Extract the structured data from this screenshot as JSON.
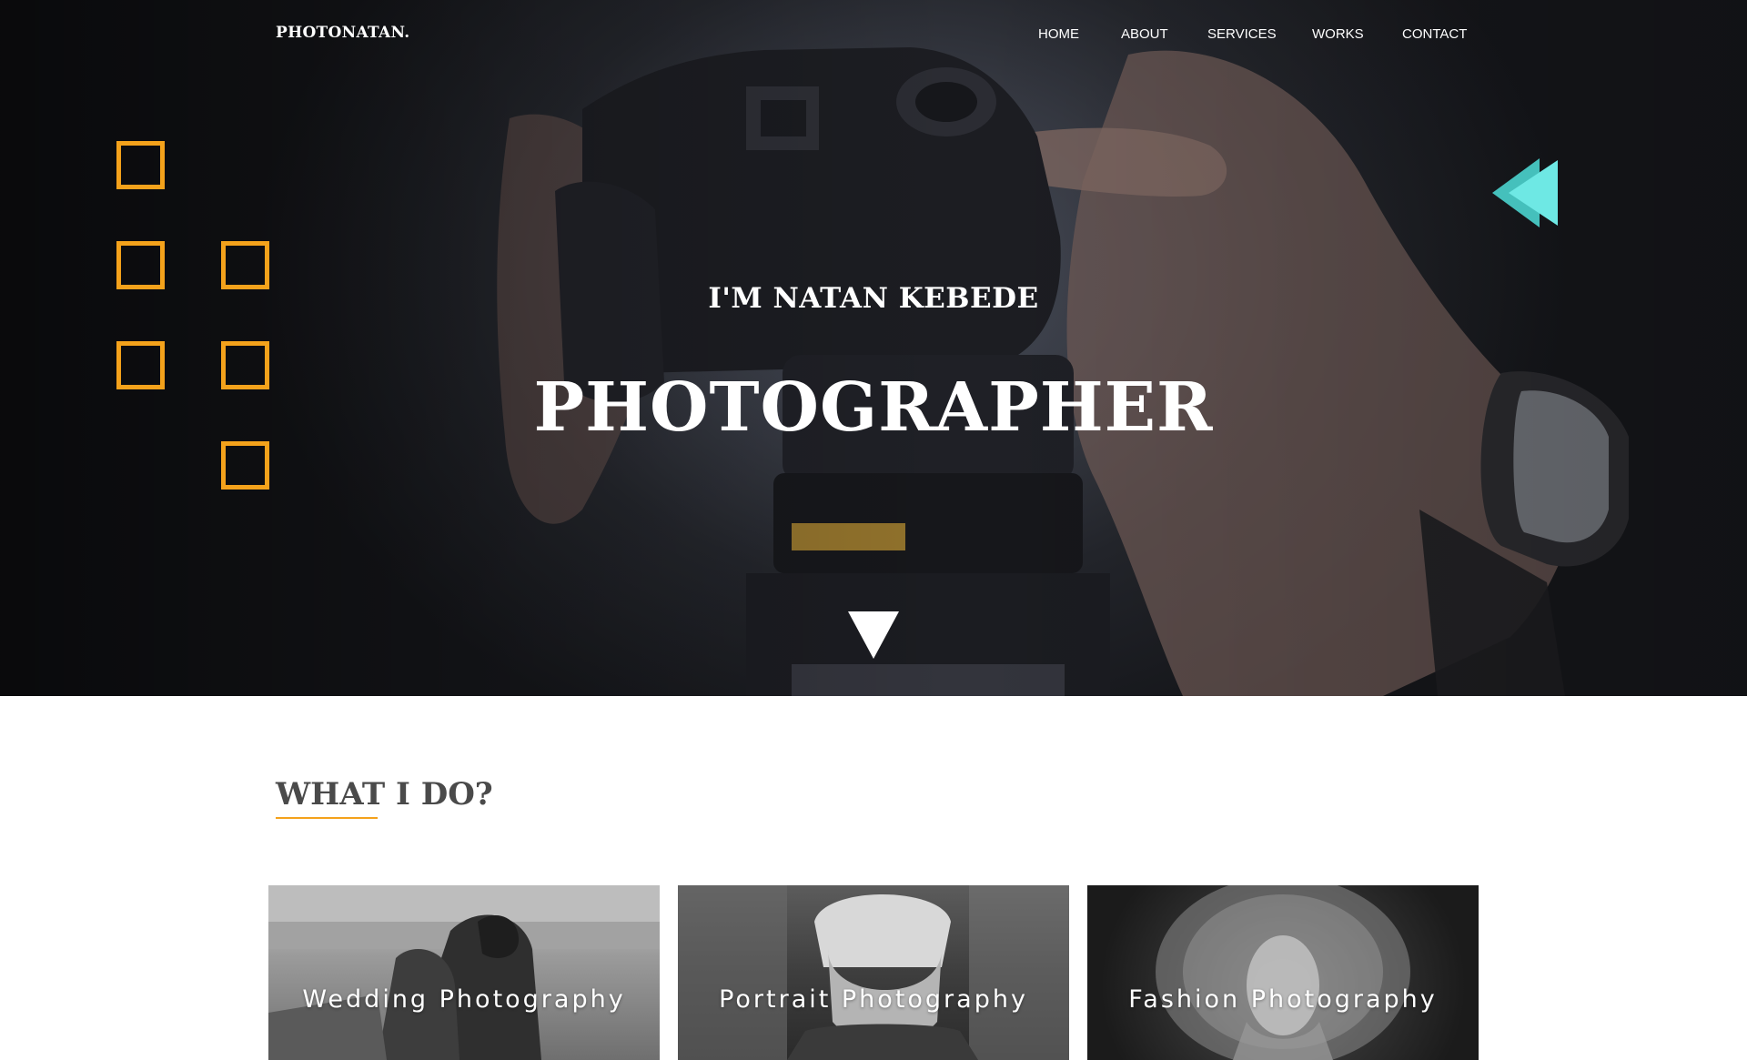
{
  "brand": "PHOTONATAN.",
  "nav": [
    {
      "label": "HOME"
    },
    {
      "label": "ABOUT"
    },
    {
      "label": "SERVICES"
    },
    {
      "label": "WORKS"
    },
    {
      "label": "CONTACT"
    }
  ],
  "hero": {
    "subtitle": "I'M NATAN KEBEDE",
    "title": "PHOTOGRAPHER"
  },
  "services": {
    "title": "WHAT I DO?",
    "cards": [
      {
        "label": "Wedding Photography"
      },
      {
        "label": "Portrait Photography"
      },
      {
        "label": "Fashion Photography"
      }
    ]
  },
  "colors": {
    "accent_orange": "#f4a21b",
    "accent_cyan": "#6ee8e4",
    "cyan_shadow": "#45c0bc",
    "text_dark": "#4a4a4a"
  },
  "icons": {
    "rewind": "rewind-icon",
    "scroll_down": "triangle-down-icon"
  }
}
